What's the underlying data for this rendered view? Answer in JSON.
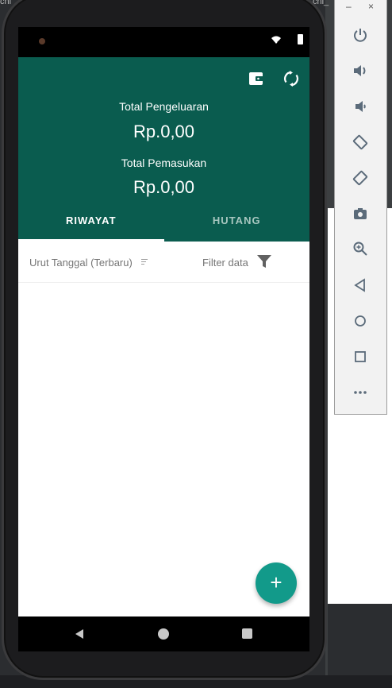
{
  "ide": {
    "top_left_text": "chi",
    "top_right_text": "chi_"
  },
  "app": {
    "total_expense_label": "Total Pengeluaran",
    "total_expense_value": "Rp.0,00",
    "total_income_label": "Total Pemasukan",
    "total_income_value": "Rp.0,00",
    "tabs": [
      {
        "label": "RIWAYAT",
        "active": true
      },
      {
        "label": "HUTANG",
        "active": false
      }
    ],
    "sort_label": "Urut Tanggal (Terbaru)",
    "filter_label": "Filter data",
    "fab_label": "+"
  },
  "emulator_toolbar": {
    "minimize": "–",
    "close": "×",
    "buttons": [
      "power-icon",
      "volume-up-icon",
      "volume-down-icon",
      "rotate-left-icon",
      "rotate-right-icon",
      "camera-icon",
      "zoom-icon",
      "back-icon",
      "home-icon",
      "overview-icon",
      "more-icon"
    ]
  },
  "colors": {
    "header": "#0a5c4f",
    "fab": "#129a8a",
    "tab_inactive": "#a8c7c0"
  }
}
